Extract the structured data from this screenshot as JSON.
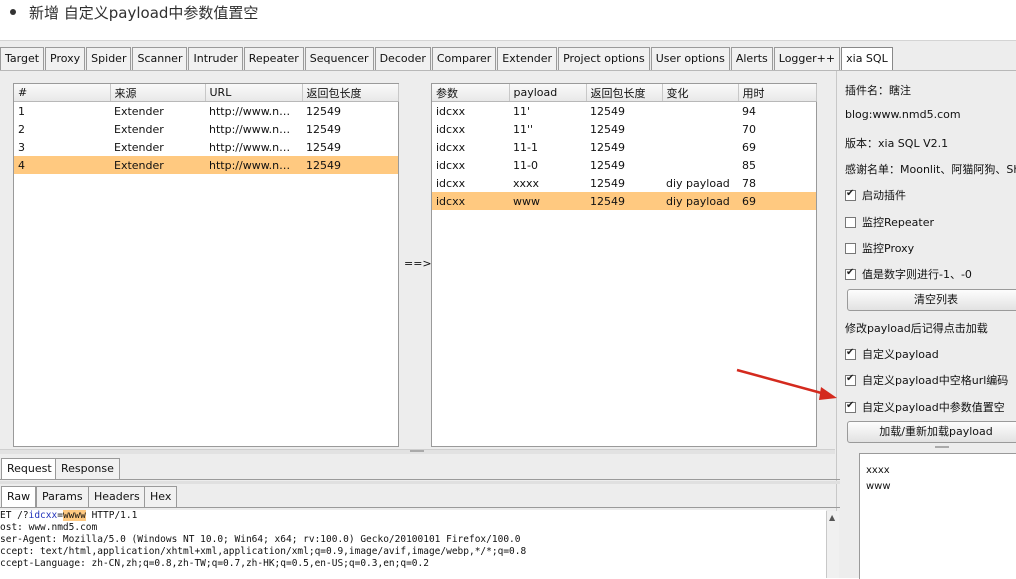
{
  "heading": "新增 自定义payload中参数值置空",
  "tabs": [
    "Target",
    "Proxy",
    "Spider",
    "Scanner",
    "Intruder",
    "Repeater",
    "Sequencer",
    "Decoder",
    "Comparer",
    "Extender",
    "Project options",
    "User options",
    "Alerts",
    "Logger++",
    "xia SQL"
  ],
  "left_table": {
    "columns": [
      "#",
      "来源",
      "URL",
      "返回包长度"
    ],
    "rows": [
      {
        "num": "1",
        "source": "Extender",
        "url": "http://www.nmd...",
        "len": "12549"
      },
      {
        "num": "2",
        "source": "Extender",
        "url": "http://www.nmd...",
        "len": "12549"
      },
      {
        "num": "3",
        "source": "Extender",
        "url": "http://www.nmd...",
        "len": "12549"
      },
      {
        "num": "4",
        "source": "Extender",
        "url": "http://www.nmd...",
        "len": "12549"
      }
    ]
  },
  "arrow_text": "==>",
  "right_table": {
    "columns": [
      "参数",
      "payload",
      "返回包长度",
      "变化",
      "用时"
    ],
    "rows": [
      {
        "param": "idcxx",
        "payload": "11'",
        "len": "12549",
        "change": "",
        "time": "94"
      },
      {
        "param": "idcxx",
        "payload": "11''",
        "len": "12549",
        "change": "",
        "time": "70"
      },
      {
        "param": "idcxx",
        "payload": "11-1",
        "len": "12549",
        "change": "",
        "time": "69"
      },
      {
        "param": "idcxx",
        "payload": "11-0",
        "len": "12549",
        "change": "",
        "time": "85"
      },
      {
        "param": "idcxx",
        "payload": "xxxx",
        "len": "12549",
        "change": "diy payload",
        "time": "78"
      },
      {
        "param": "idcxx",
        "payload": "www",
        "len": "12549",
        "change": "diy payload",
        "time": "69"
      }
    ]
  },
  "side": {
    "plugin_name": "插件名：瞎注",
    "blog": "blog:www.nmd5.com",
    "version": "版本：xia SQL V2.1",
    "thanks": "感谢名单：Moonlit、阿猫阿狗、Sh",
    "opt_enable": "启动插件",
    "opt_repeater": "监控Repeater",
    "opt_proxy": "监控Proxy",
    "opt_numeric": "值是数字则进行-1、-0",
    "clear_btn": "清空列表",
    "note": "修改payload后记得点击加载",
    "opt_custom": "自定义payload",
    "opt_urlencode": "自定义payload中空格url编码",
    "opt_empty": "自定义payload中参数值置空",
    "load_btn": "加载/重新加载payload",
    "payload_list": [
      "xxxx",
      "www"
    ]
  },
  "req_tabs": [
    "Request",
    "Response"
  ],
  "raw_tabs": [
    "Raw",
    "Params",
    "Headers",
    "Hex"
  ],
  "request": {
    "l1_a": "ET /?",
    "l1_param": "idcxx",
    "l1_eq": "=",
    "l1_val": "wwww",
    "l1_b": " HTTP/1.1",
    "l2": "ost: www.nmd5.com",
    "l3": "ser-Agent: Mozilla/5.0 (Windows NT 10.0; Win64; x64; rv:100.0) Gecko/20100101 Firefox/100.0",
    "l4": "ccept: text/html,application/xhtml+xml,application/xml;q=0.9,image/avif,image/webp,*/*;q=0.8",
    "l5": "ccept-Language: zh-CN,zh;q=0.8,zh-TW;q=0.7,zh-HK;q=0.5,en-US;q=0.3,en;q=0.2"
  },
  "colors": {
    "selected_row": "#ffc980",
    "annotation_arrow": "#d42a1e"
  }
}
